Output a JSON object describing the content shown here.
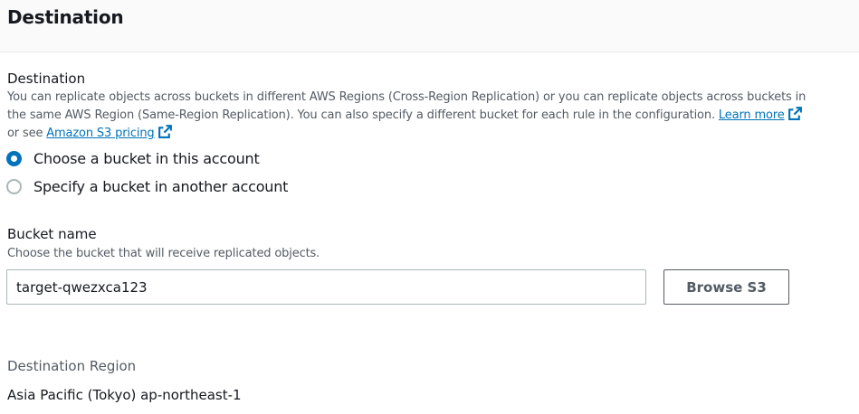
{
  "header": {
    "title": "Destination"
  },
  "destination": {
    "label": "Destination",
    "description_line1": "You can replicate objects across buckets in different AWS Regions (Cross-Region Replication) or you can replicate objects across buckets in",
    "description_line2": "the same AWS Region (Same-Region Replication). You can also specify a different bucket for each rule in the configuration.",
    "learn_more": "Learn more",
    "or_see": "or see",
    "pricing_link": "Amazon S3 pricing",
    "options": [
      {
        "label": "Choose a bucket in this account",
        "selected": true
      },
      {
        "label": "Specify a bucket in another account",
        "selected": false
      }
    ]
  },
  "bucket": {
    "label": "Bucket name",
    "description": "Choose the bucket that will receive replicated objects.",
    "value": "target-qwezxca123",
    "browse_label": "Browse S3"
  },
  "region": {
    "label": "Destination Region",
    "value": "Asia Pacific (Tokyo) ap-northeast-1"
  },
  "colors": {
    "link": "#0073bb",
    "radio_selected": "#0073bb",
    "text": "#16191f",
    "muted": "#545b64"
  },
  "icons": [
    "external-link-icon"
  ]
}
